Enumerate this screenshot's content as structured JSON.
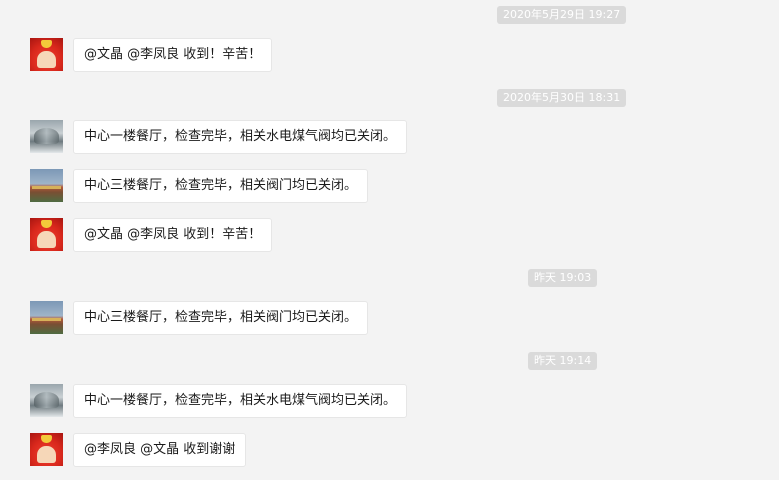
{
  "chat": {
    "timestamps": [
      "2020年5月29日 19:27",
      "2020年5月30日 18:31",
      "昨天 19:03",
      "昨天 19:14"
    ],
    "messages": [
      {
        "avatar": "red-avatar",
        "text": "@文晶 @李凤良 收到！辛苦！"
      },
      {
        "avatar": "snow-avatar",
        "text": "中心一楼餐厅，检查完毕，相关水电煤气阀均已关闭。"
      },
      {
        "avatar": "landscape-avatar",
        "text": "中心三楼餐厅，检查完毕，相关阀门均已关闭。"
      },
      {
        "avatar": "red-avatar",
        "text": "@文晶 @李凤良 收到！辛苦！"
      },
      {
        "avatar": "landscape-avatar",
        "text": "中心三楼餐厅，检查完毕，相关阀门均已关闭。"
      },
      {
        "avatar": "snow-avatar",
        "text": "中心一楼餐厅，检查完毕，相关水电煤气阀均已关闭。"
      },
      {
        "avatar": "red-avatar",
        "text": "@李凤良 @文晶 收到谢谢"
      }
    ]
  }
}
